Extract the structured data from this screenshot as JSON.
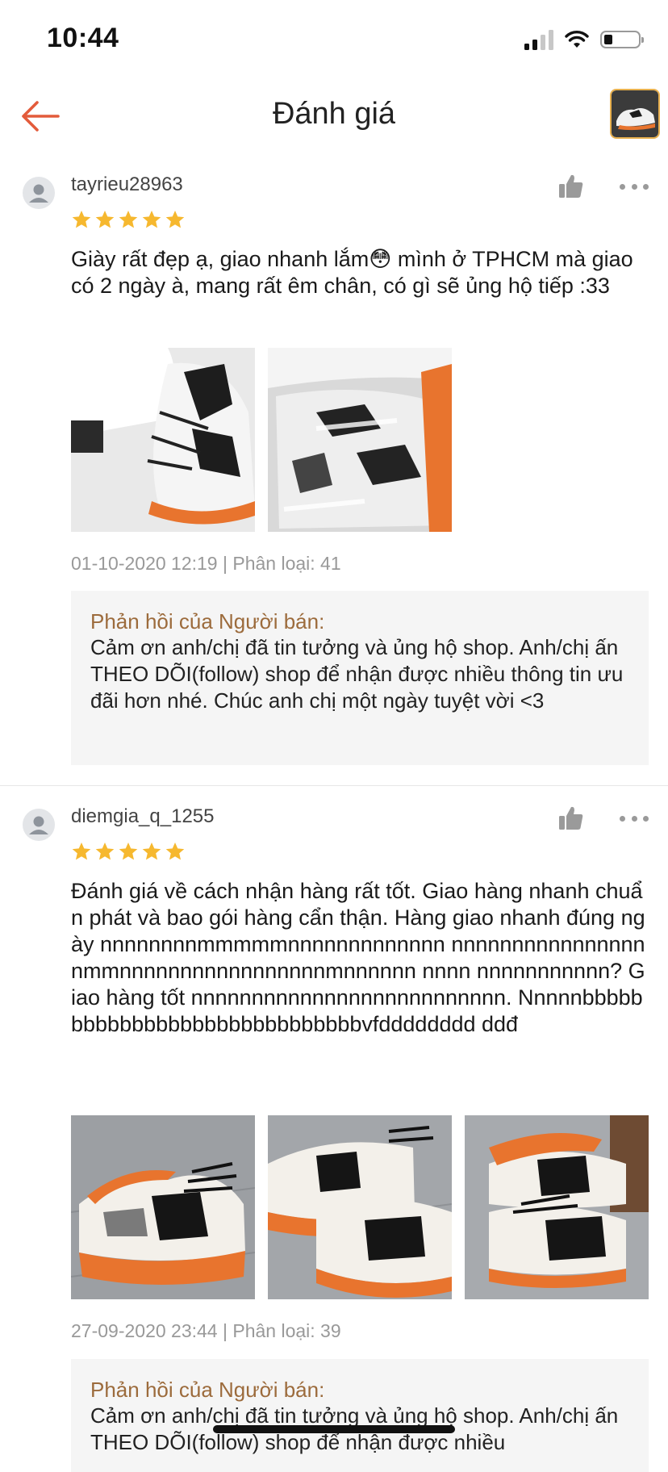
{
  "status_bar": {
    "time": "10:44"
  },
  "nav": {
    "title": "Đánh giá",
    "back_icon": "arrow-left-icon",
    "accent_color": "#e35b3b"
  },
  "reviews": [
    {
      "username": "tayrieu28963",
      "rating": 5,
      "text": "Giày rất đẹp ạ, giao nhanh lắm😳 mình ở TPHCM mà giao có 2 ngày à,  mang rất êm chân, có gì sẽ ủng hộ tiếp :33",
      "photo_count": 2,
      "meta": "01-10-2020 12:19 | Phân loại: 41",
      "seller_reply": {
        "title": "Phản hồi của Người bán:",
        "text": "Cảm ơn anh/chị đã tin tưởng và ủng hộ shop. Anh/chị ấn THEO DÕI(follow) shop để nhận được nhiều thông tin ưu đãi hơn nhé.  Chúc anh chị một ngày tuyệt vời <3"
      }
    },
    {
      "username": "diemgia_q_1255",
      "rating": 5,
      "text": "Đánh giá về cách nhận hàng rất tốt. Giao hàng nhanh chuẩn phát và bao gói hàng cẩn thận. Hàng giao nhanh đúng ngày nnnnnnnnmmmmmnnnnnnnnnnnnn nnnnnnnnnnnnnnnnnmmnnnnnnnnnnnnnnnnnmnnnnnn nnnn nnnnnnnnnnn? Giao hàng tốt nnnnnnnnnnnnnnnnnnnnnnnnnn. Nnnnnbbbbbbbbbbbbbbbbbbbbbbbbbbbbbvfdddddddd ddđ",
      "photo_count": 3,
      "meta": "27-09-2020 23:44 | Phân loại: 39",
      "seller_reply": {
        "title": "Phản hồi của Người bán:",
        "text": "Cảm ơn anh/chị đã tin tưởng và ủng hộ shop. Anh/chị ấn THEO DÕI(follow) shop để nhận được nhiều"
      }
    }
  ],
  "colors": {
    "star": "#f6b82f",
    "reply_title": "#9c6b3c",
    "meta": "#999999",
    "reply_background": "#f5f5f5"
  },
  "icons": [
    "arrow-left-icon",
    "thumbs-up-icon",
    "more-dots-icon",
    "star-icon",
    "user-avatar-icon",
    "wifi-icon",
    "signal-icon",
    "battery-icon"
  ]
}
